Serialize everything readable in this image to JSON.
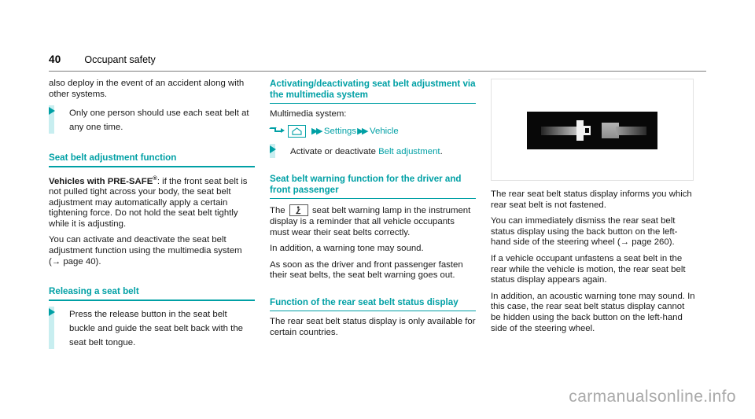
{
  "header": {
    "page_number": "40",
    "section_title": "Occupant safety"
  },
  "colors": {
    "teal": "#00a0a5",
    "step_bar": "#c8eef0",
    "rule": "#7d7d7d",
    "watermark": "#a9a9a9"
  },
  "column1": {
    "continued_paragraph": "also deploy in the event of an accident along with other systems.",
    "step1": "Only one person should use each seat belt at any one time.",
    "heading_adjustment": "Seat belt adjustment function",
    "para_presafe_lead": "Vehicles with PRE-SAFE",
    "para_presafe_sup": "®",
    "para_presafe_rest": ": if the front seat belt is not pulled tight across your body, the seat belt adjustment may automatically apply a certain tightening force. Do not hold the seat belt tightly while it is adjusting.",
    "para_activate": "You can activate and deactivate the seat belt adjustment function using the multimedia system (→ page 40).",
    "heading_releasing": "Releasing a seat belt",
    "step_release": "Press the release button in the seat belt buckle and guide the seat belt back with the seat belt tongue."
  },
  "column2": {
    "heading_activating": "Activating/deactivating seat belt adjustment via the multimedia system",
    "multimedia_label": "Multimedia system:",
    "path": {
      "arrow_icon": "turn-arrow-icon",
      "home_icon": "home-icon",
      "chevron": "▶▶",
      "item1": "Settings",
      "item2": "Vehicle"
    },
    "step_activate_pre": "Activate or deactivate ",
    "step_activate_link": "Belt adjustment",
    "step_activate_post": ".",
    "heading_warning": "Seat belt warning function for the driver and front passenger",
    "para_warning_pre": "The ",
    "warning_lamp_icon": "seat-belt-warning-lamp-icon",
    "para_warning_post": " seat belt warning lamp in the instrument display is a reminder that all vehicle occupants must wear their seat belts correctly.",
    "para_tone": "In addition, a warning tone may sound.",
    "para_fasten": "As soon as the driver and front passenger fasten their seat belts, the seat belt warning goes out.",
    "heading_status": "Function of the rear seat belt status display",
    "para_status": "The rear seat belt status display is only available for certain countries."
  },
  "column3": {
    "figure_name": "rear-seat-belt-status-display-illustration",
    "para_informs": "The rear seat belt status display informs you which rear seat belt is not fastened.",
    "para_dismiss": "You can immediately dismiss the rear seat belt status display using the back button on the left-hand side of the steering wheel (→ page 260).",
    "para_unfastens": "If a vehicle occupant unfastens a seat belt in the rear while the vehicle is motion, the rear seat belt status display appears again.",
    "para_acoustic": "In addition, an acoustic warning tone may sound. In this case, the rear seat belt status display cannot be hidden using the back button on the left-hand side of the steering wheel."
  },
  "watermark": "carmanualsonline.info"
}
